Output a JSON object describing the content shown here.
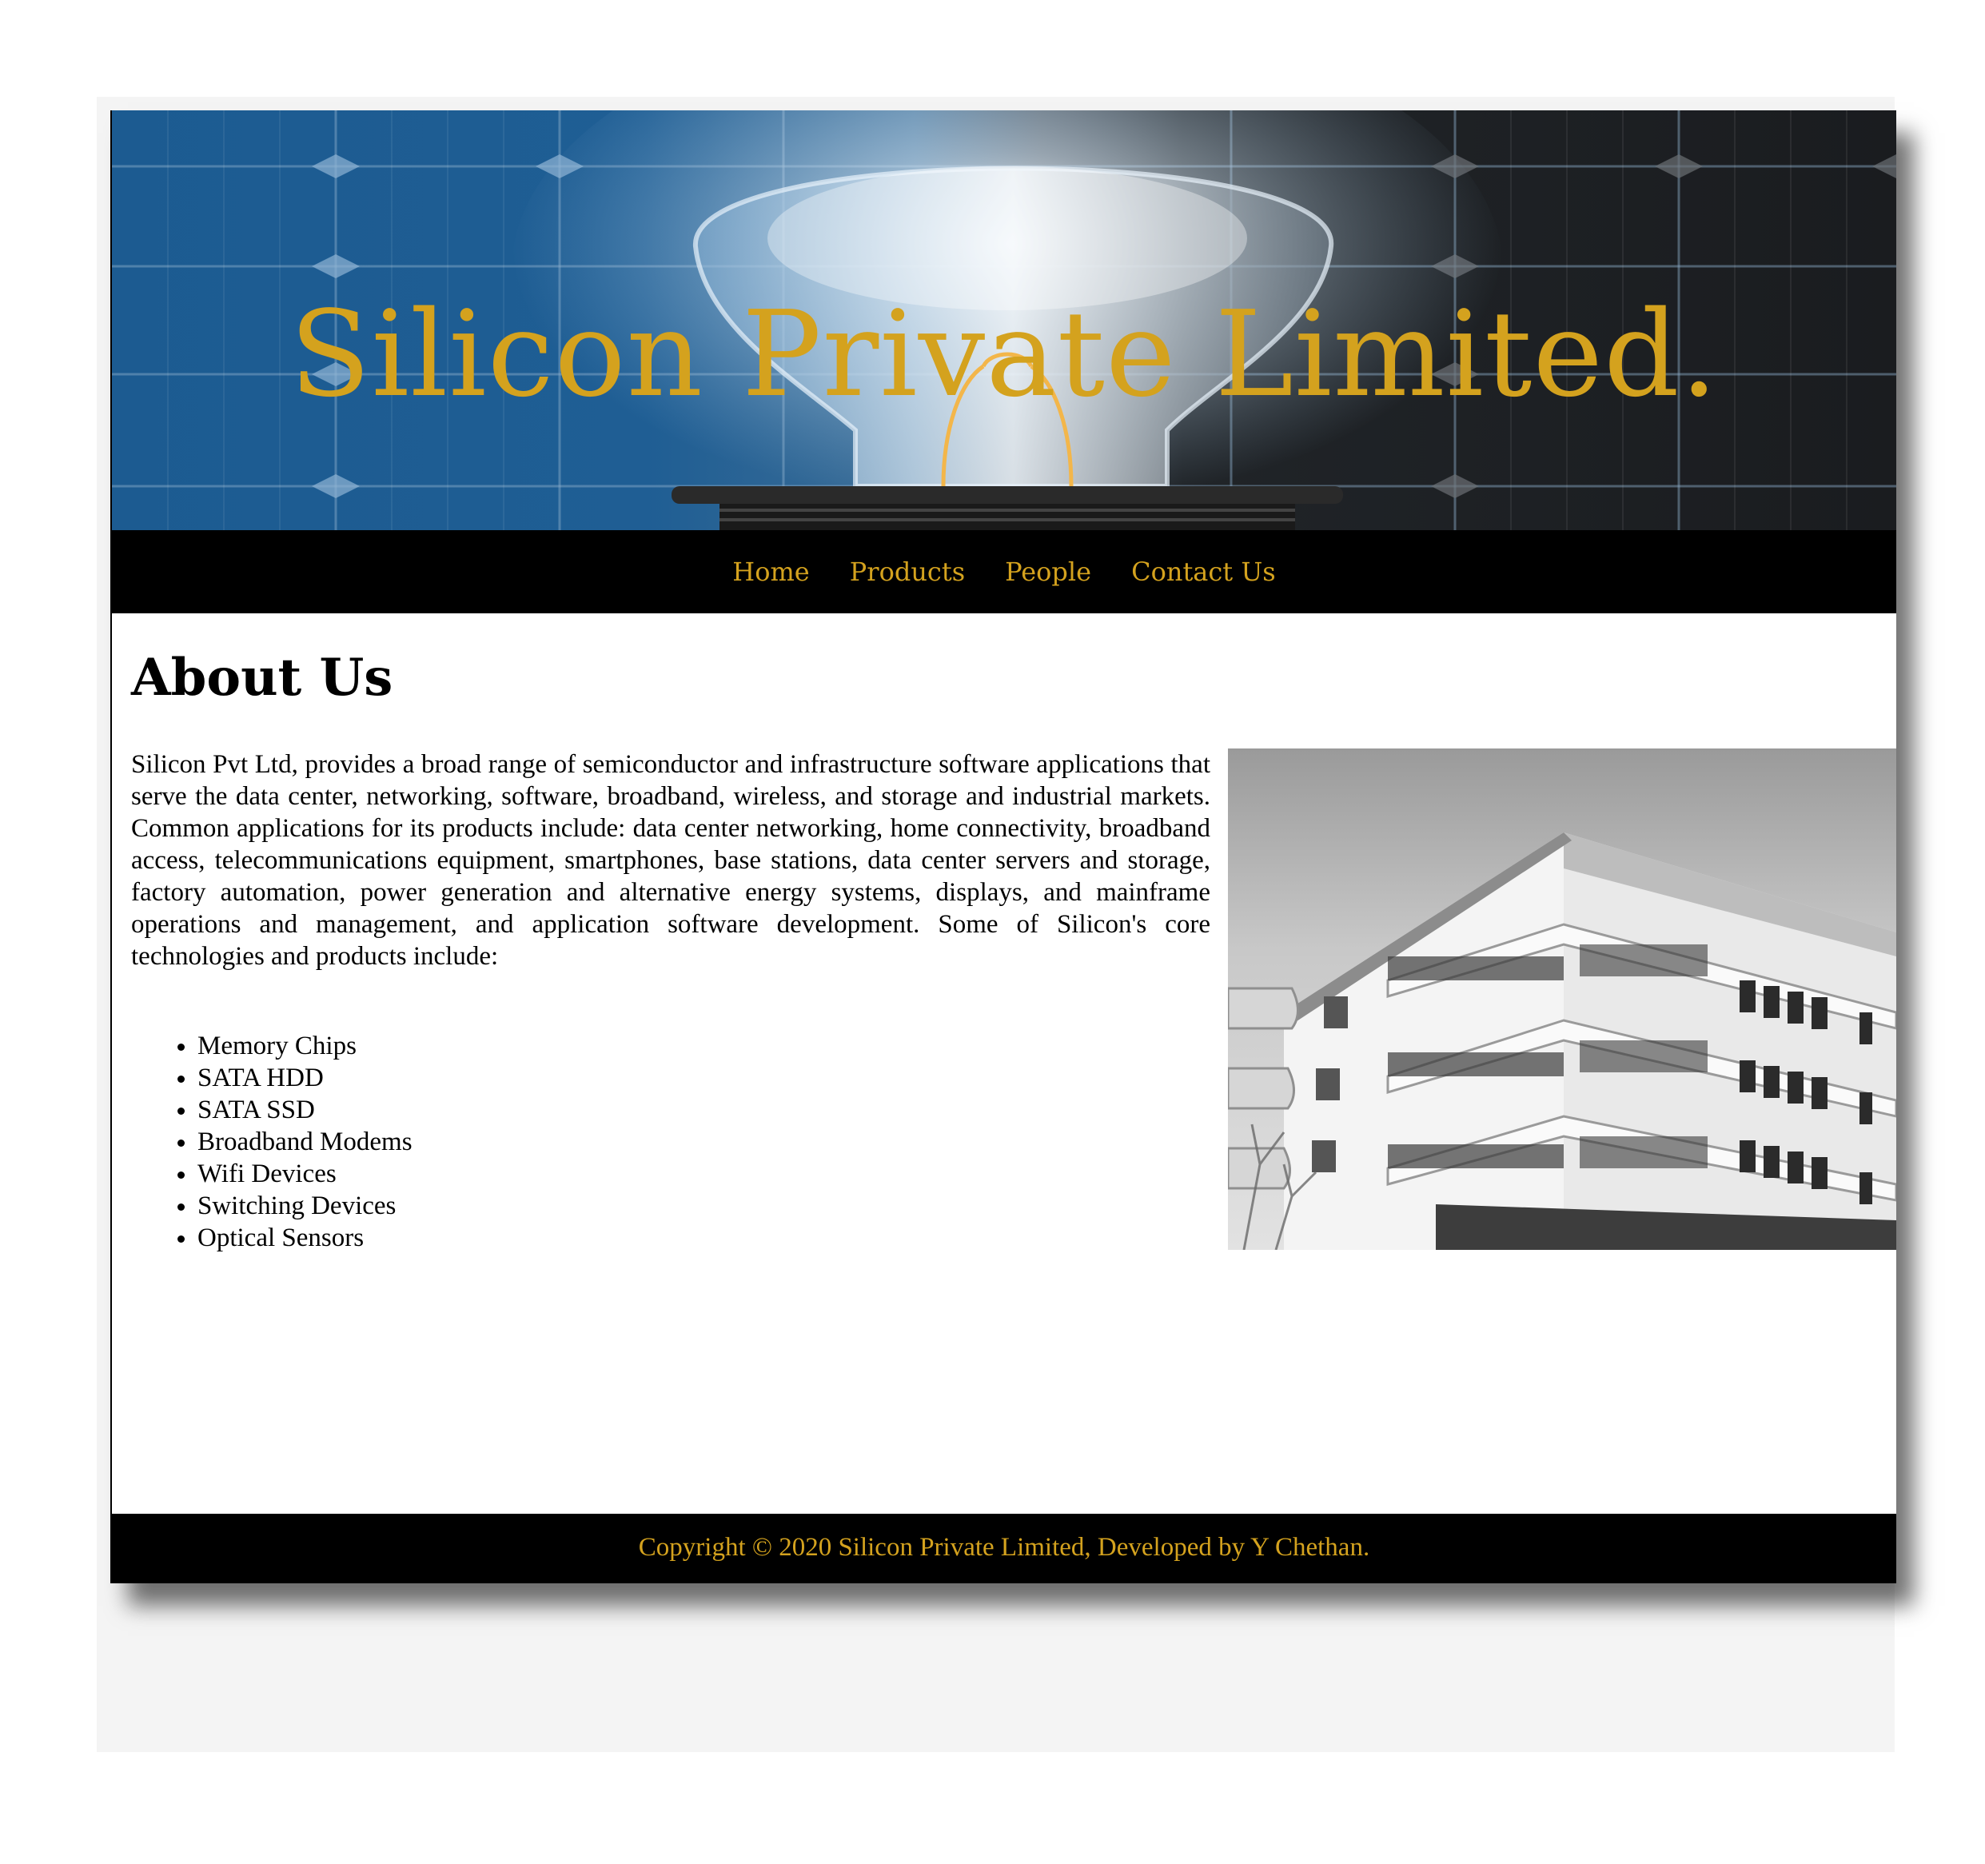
{
  "header": {
    "title": "Silicon Private Limited."
  },
  "nav": {
    "items": [
      "Home",
      "Products",
      "People",
      "Contact Us"
    ]
  },
  "about": {
    "heading": "About Us",
    "intro": "Silicon Pvt Ltd, provides a broad range of semiconductor and infrastructure software applications that serve the data center, networking, software, broadband, wireless, and storage and industrial markets. Common applications for its products include: data center networking, home connectivity, broadband access, telecommunications equipment, smartphones, base stations, data center servers and storage, factory automation, power generation and alternative energy systems, displays, and mainframe operations and management, and application software development. Some of Silicon's core technologies and products include:",
    "products": [
      "Memory Chips",
      "SATA HDD",
      "SATA SSD",
      "Broadband Modems",
      "Wifi Devices",
      "Switching Devices",
      "Optical Sensors"
    ]
  },
  "footer": {
    "text": "Copyright © 2020 Silicon Private Limited, Developed by Y Chethan."
  },
  "colors": {
    "accent": "#d4a21e",
    "nav_bg": "#000000",
    "page_bg": "#f4f4f4"
  }
}
